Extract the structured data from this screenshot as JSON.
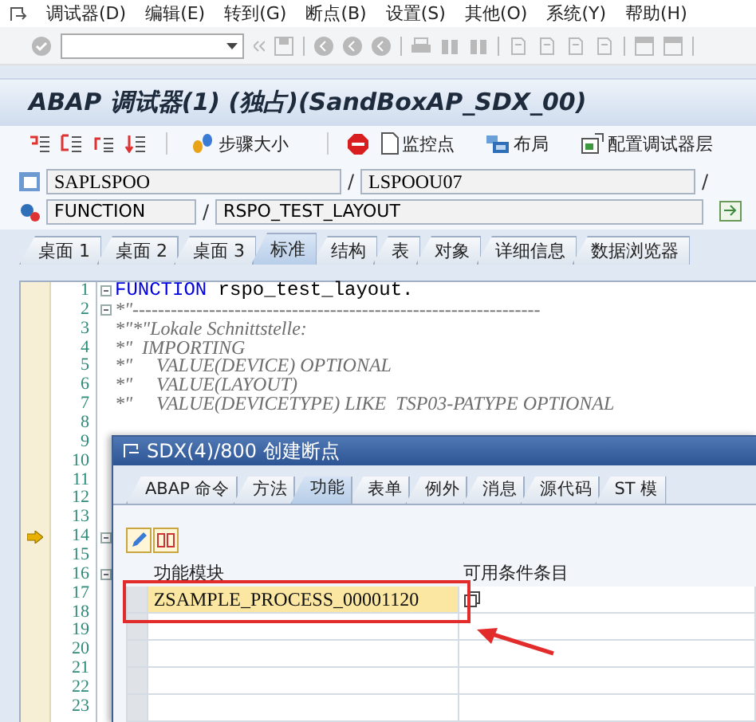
{
  "menu": [
    {
      "label": "调试器(D)"
    },
    {
      "label": "编辑(E)"
    },
    {
      "label": "转到(G)"
    },
    {
      "label": "断点(B)"
    },
    {
      "label": "设置(S)"
    },
    {
      "label": "其他(O)"
    },
    {
      "label": "系统(Y)"
    },
    {
      "label": "帮助(H)"
    }
  ],
  "window": {
    "title": "ABAP 调试器(1) (独占)(SandBoxAP_SDX_00)"
  },
  "app_toolbar": [
    {
      "kind": "icon"
    },
    {
      "kind": "icon"
    },
    {
      "kind": "icon"
    },
    {
      "kind": "icon"
    },
    {
      "kind": "separator"
    },
    {
      "kind": "button",
      "label": "步骤大小"
    },
    {
      "kind": "separator"
    },
    {
      "kind": "icon"
    },
    {
      "kind": "button",
      "label": "监控点"
    },
    {
      "kind": "button",
      "label": "布局"
    },
    {
      "kind": "button",
      "label": "配置调试器层"
    }
  ],
  "source": {
    "program": "SAPLSPOO",
    "separator_1": "/",
    "include": "LSPOOU07",
    "separator_2": "/",
    "event_type": "FUNCTION",
    "separator_3": "/",
    "event_name": "RSPO_TEST_LAYOUT"
  },
  "tabs": [
    {
      "label": "桌面 1",
      "selected": false
    },
    {
      "label": "桌面 2",
      "selected": false
    },
    {
      "label": "桌面 3",
      "selected": false
    },
    {
      "label": "标准",
      "selected": true
    },
    {
      "label": "结构",
      "selected": false
    },
    {
      "label": "表",
      "selected": false
    },
    {
      "label": "对象",
      "selected": false
    },
    {
      "label": "详细信息",
      "selected": false
    },
    {
      "label": "数据浏览器",
      "selected": false
    }
  ],
  "code_lines": [
    {
      "number": "1",
      "kind": "statement",
      "keyword": "FUNCTION",
      "text": "rspo_test_layout.",
      "current": false,
      "fold": true
    },
    {
      "number": "2",
      "kind": "comment",
      "text": "*\"----------------------------------------------------------------",
      "current": false,
      "fold": true
    },
    {
      "number": "3",
      "kind": "comment",
      "text": "*\"*\"Lokale Schnittstelle:",
      "current": false,
      "fold": false
    },
    {
      "number": "4",
      "kind": "comment",
      "text": "*\"  IMPORTING",
      "current": false,
      "fold": false
    },
    {
      "number": "5",
      "kind": "comment",
      "text": "*\"     VALUE(DEVICE) OPTIONAL",
      "current": false,
      "fold": false
    },
    {
      "number": "6",
      "kind": "comment",
      "text": "*\"     VALUE(LAYOUT)",
      "current": false,
      "fold": false
    },
    {
      "number": "7",
      "kind": "comment",
      "text": "*\"     VALUE(DEVICETYPE) LIKE  TSP03-PATYPE OPTIONAL",
      "current": false,
      "fold": false
    },
    {
      "number": "8",
      "kind": "hidden",
      "current": false,
      "fold": false
    },
    {
      "number": "9",
      "kind": "hidden",
      "current": false,
      "fold": false
    },
    {
      "number": "10",
      "kind": "hidden",
      "current": false,
      "fold": false
    },
    {
      "number": "11",
      "kind": "hidden",
      "current": false,
      "fold": false
    },
    {
      "number": "12",
      "kind": "hidden",
      "current": false,
      "fold": false
    },
    {
      "number": "13",
      "kind": "hidden",
      "current": false,
      "fold": false
    },
    {
      "number": "14",
      "kind": "hidden",
      "current": true,
      "fold": true
    },
    {
      "number": "15",
      "kind": "hidden",
      "current": false,
      "fold": false
    },
    {
      "number": "16",
      "kind": "hidden",
      "current": false,
      "fold": true
    },
    {
      "number": "17",
      "kind": "hidden",
      "current": false,
      "fold": false
    },
    {
      "number": "18",
      "kind": "hidden",
      "current": false,
      "fold": false
    },
    {
      "number": "19",
      "kind": "hidden",
      "current": false,
      "fold": false
    },
    {
      "number": "20",
      "kind": "hidden",
      "current": false,
      "fold": false
    },
    {
      "number": "21",
      "kind": "hidden",
      "current": false,
      "fold": false
    },
    {
      "number": "22",
      "kind": "hidden",
      "current": false,
      "fold": false
    },
    {
      "number": "23",
      "kind": "hidden",
      "current": false,
      "fold": false
    }
  ],
  "dialog": {
    "title": "SDX(4)/800 创建断点",
    "tabs": [
      {
        "label": "ABAP 命令",
        "selected": false
      },
      {
        "label": "方法",
        "selected": false
      },
      {
        "label": "功能",
        "selected": true
      },
      {
        "label": "表单",
        "selected": false
      },
      {
        "label": "例外",
        "selected": false
      },
      {
        "label": "消息",
        "selected": false
      },
      {
        "label": "源代码",
        "selected": false
      },
      {
        "label": "ST 模",
        "selected": false
      }
    ],
    "table": {
      "columns": [
        "功能模块",
        "可用条件条目"
      ],
      "rows": [
        {
          "cells": [
            "ZSAMPLE_PROCESS_00001120",
            ""
          ],
          "highlighted": true
        },
        {
          "cells": [
            "",
            ""
          ],
          "highlighted": false
        },
        {
          "cells": [
            "",
            ""
          ],
          "highlighted": false
        },
        {
          "cells": [
            "",
            ""
          ],
          "highlighted": false
        },
        {
          "cells": [
            "",
            ""
          ],
          "highlighted": false
        }
      ]
    }
  }
}
